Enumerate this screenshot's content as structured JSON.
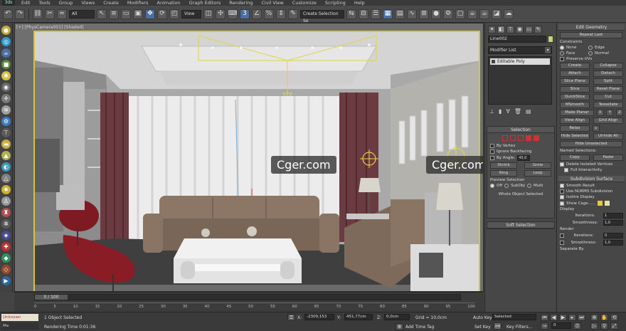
{
  "menubar": {
    "logo": "3ds",
    "items": [
      "Edit",
      "Tools",
      "Group",
      "Views",
      "Create",
      "Modifiers",
      "Animation",
      "Graph Editors",
      "Rendering",
      "Civil View",
      "Customize",
      "Scripting",
      "Help"
    ]
  },
  "toolbar": {
    "filter_select": "All",
    "view_select": "View",
    "selection_set": "Create Selection Se"
  },
  "viewport": {
    "label": "[+] [PhysCamera001] [Shaded]",
    "watermark_left": "Cger.com",
    "watermark_right": "Cger.com"
  },
  "timeline": {
    "slider_label": "0 / 100",
    "ticks": [
      "0",
      "5",
      "10",
      "15",
      "20",
      "25",
      "30",
      "35",
      "40",
      "45",
      "50",
      "55",
      "60",
      "65",
      "70",
      "75",
      "80",
      "85",
      "90",
      "95",
      "100"
    ]
  },
  "statusbar": {
    "script_line1": "Unknown",
    "script_line2": "Ma",
    "objects_selected": "1 Object Selected",
    "render_time": "Rendering Time  0:01:36",
    "x_label": "X:",
    "x_value": "-2309,153",
    "y_label": "Y:",
    "y_value": "451,77cm",
    "z_label": "Z:",
    "z_value": "0,0cm",
    "grid": "Grid = 10,0cm",
    "add_time_tag": "Add Time Tag",
    "auto_key": "Auto Key",
    "set_key": "Set Key",
    "key_mode": "Selected",
    "key_filters": "Key Filters...",
    "frame": "0"
  },
  "command_panel": {
    "object_name": "Line002",
    "modifier_list": "Modifier List",
    "stack_item": "Editable Poly",
    "selection": {
      "title": "Selection",
      "by_vertex": "By Vertex",
      "ignore_backfacing": "Ignore Backfacing",
      "by_angle": "By Angle:",
      "angle_value": "45,0",
      "shrink": "Shrink",
      "grow": "Grow",
      "ring": "Ring",
      "loop": "Loop",
      "preview_selection": "Preview Selection",
      "off": "Off",
      "subobj": "SubObj",
      "multi": "Multi",
      "whole_object": "Whole Object Selected"
    },
    "soft_selection": "Soft Selection"
  },
  "edit_geometry": {
    "title": "Edit Geometry",
    "repeat_last": "Repeat Last",
    "constraints": "Constraints",
    "none": "None",
    "edge": "Edge",
    "face": "Face",
    "normal": "Normal",
    "preserve_uvs": "Preserve UVs",
    "create": "Create",
    "collapse": "Collapse",
    "attach": "Attach",
    "detach": "Detach",
    "slice_plane": "Slice Plane",
    "split": "Split",
    "slice": "Slice",
    "reset_plane": "Reset Plane",
    "quickslice": "QuickSlice",
    "cut": "Cut",
    "msmooth": "MSmooth",
    "tessellate": "Tessellate",
    "make_planar": "Make Planar",
    "x": "X",
    "y": "Y",
    "z": "Z",
    "view_align": "View Align",
    "grid_align": "Grid Align",
    "relax": "Relax",
    "hide_selected": "Hide Selected",
    "unhide_all": "Unhide All",
    "hide_unselected": "Hide Unselected",
    "named_selections": "Named Selections:",
    "copy": "Copy",
    "paste": "Paste",
    "delete_isolated": "Delete Isolated Vertices",
    "full_interactivity": "Full Interactivity"
  },
  "subdivision": {
    "title": "Subdivision Surface",
    "smooth_result": "Smooth Result",
    "use_nurms": "Use NURMS Subdivision",
    "isoline": "Isoline Display",
    "show_cage": "Show Cage......",
    "cage_color1": "#e8c83a",
    "cage_color2": "#e8e0a0",
    "display": "Display",
    "iterations_label": "Iterations:",
    "iterations_value": "1",
    "smoothness_label": "Smoothness:",
    "smoothness_value": "1,0",
    "render": "Render",
    "render_iterations_value": "0",
    "render_smoothness_value": "1,0",
    "separate_by": "Separate By"
  }
}
